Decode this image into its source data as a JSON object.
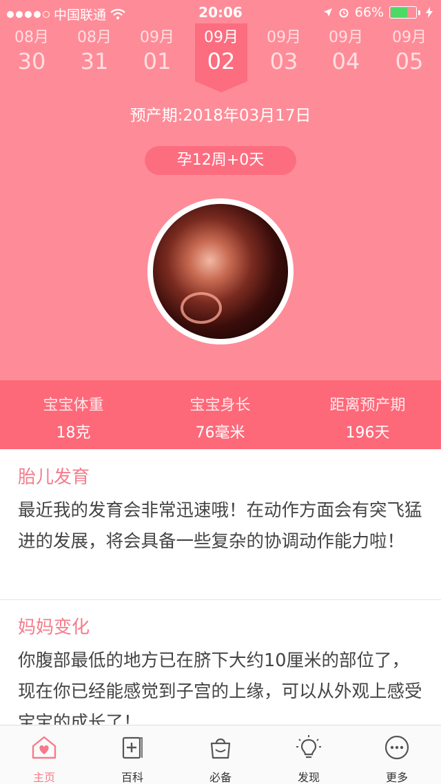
{
  "status": {
    "carrier": "中国联通",
    "time": "20:06",
    "battery": "66%",
    "battery_level": 0.66,
    "signal_dots_full": 4,
    "signal_dots_total": 5
  },
  "dates": [
    {
      "month": "08月",
      "day": "30"
    },
    {
      "month": "08月",
      "day": "31"
    },
    {
      "month": "09月",
      "day": "01"
    },
    {
      "month": "09月",
      "day": "02"
    },
    {
      "month": "09月",
      "day": "03"
    },
    {
      "month": "09月",
      "day": "04"
    },
    {
      "month": "09月",
      "day": "05"
    }
  ],
  "selected_date_index": 3,
  "due_date": "预产期:2018年03月17日",
  "pregnancy_week": "孕12周+0天",
  "stats": [
    {
      "label": "宝宝体重",
      "value": "18克"
    },
    {
      "label": "宝宝身长",
      "value": "76毫米"
    },
    {
      "label": "距离预产期",
      "value": "196天"
    }
  ],
  "sections": [
    {
      "title": "胎儿发育",
      "text": "最近我的发育会非常迅速哦！在动作方面会有突飞猛进的发展，将会具备一些复杂的协调动作能力啦！"
    },
    {
      "title": "妈妈变化",
      "text": "你腹部最低的地方已在脐下大约10厘米的部位了，现在你已经能感觉到子宫的上缘，可以从外观上感受宝宝的成长了！"
    }
  ],
  "tabs": [
    {
      "label": "主页",
      "icon": "home-heart-icon"
    },
    {
      "label": "百科",
      "icon": "encyclopedia-icon"
    },
    {
      "label": "必备",
      "icon": "bag-icon"
    },
    {
      "label": "发现",
      "icon": "lightbulb-icon"
    },
    {
      "label": "更多",
      "icon": "more-icon"
    }
  ],
  "colors": {
    "header_bg": "#fe8c98",
    "stats_bg": "#fd6979",
    "accent": "#f67a8a",
    "selected_tab": "#f67a8a"
  }
}
